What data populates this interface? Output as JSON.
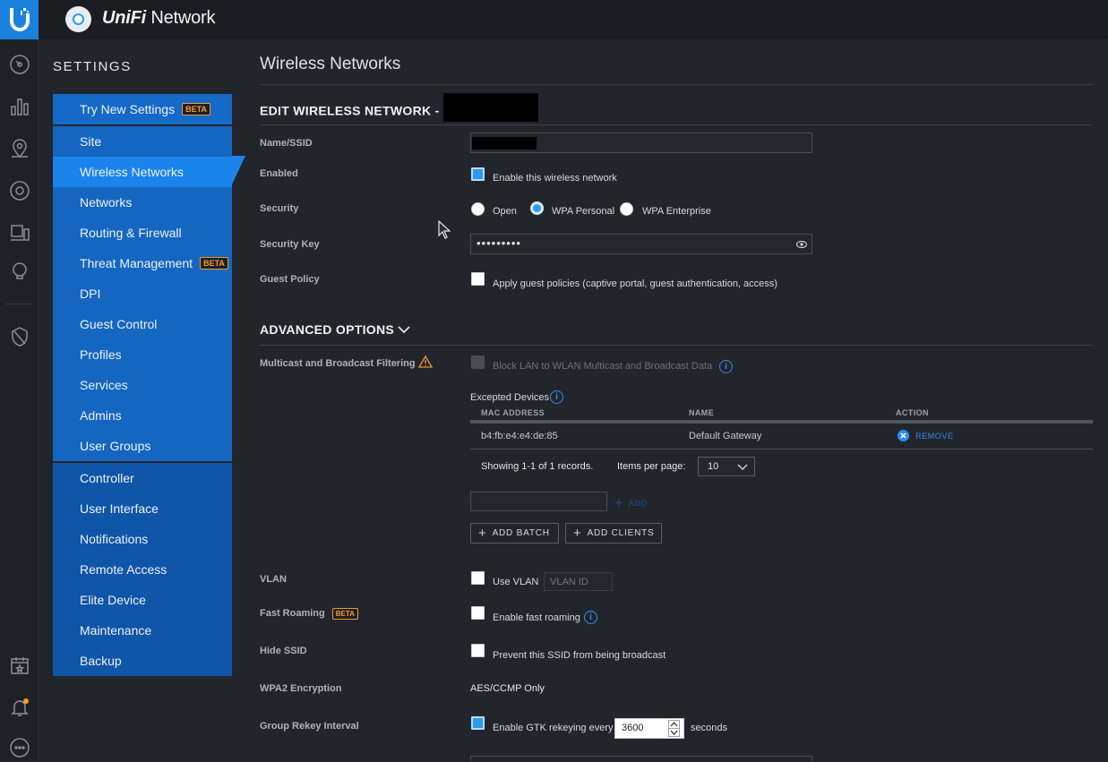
{
  "app": {
    "brand_prefix": "UniFi",
    "brand_suffix": " Network"
  },
  "sidebar": {
    "title": "SETTINGS",
    "group1": [
      {
        "label": "Try New Settings",
        "badge": "BETA"
      }
    ],
    "group2": [
      {
        "label": "Site"
      },
      {
        "label": "Wireless Networks",
        "active": true
      },
      {
        "label": "Networks"
      },
      {
        "label": "Routing & Firewall"
      },
      {
        "label": "Threat Management",
        "badge": "BETA"
      },
      {
        "label": "DPI"
      },
      {
        "label": "Guest Control"
      },
      {
        "label": "Profiles"
      },
      {
        "label": "Services"
      },
      {
        "label": "Admins"
      },
      {
        "label": "User Groups"
      }
    ],
    "group3": [
      {
        "label": "Controller"
      },
      {
        "label": "User Interface"
      },
      {
        "label": "Notifications"
      },
      {
        "label": "Remote Access"
      },
      {
        "label": "Elite Device"
      },
      {
        "label": "Maintenance"
      },
      {
        "label": "Backup"
      }
    ]
  },
  "main": {
    "page_title": "Wireless Networks",
    "edit_title": "EDIT WIRELESS NETWORK -",
    "labels": {
      "name_ssid": "Name/SSID",
      "enabled": "Enabled",
      "security": "Security",
      "security_key": "Security Key",
      "guest_policy": "Guest Policy",
      "multicast": "Multicast and Broadcast Filtering",
      "vlan": "VLAN",
      "fast_roaming": "Fast Roaming",
      "hide_ssid": "Hide SSID",
      "wpa2_encryption": "WPA2 Encryption",
      "group_rekey": "Group Rekey Interval"
    },
    "enabled_text": "Enable this wireless network",
    "security_options": [
      "Open",
      "WPA Personal",
      "WPA Enterprise"
    ],
    "security_selected": "WPA Personal",
    "security_key_value": "•••••••••",
    "guest_policy_text": "Apply guest policies (captive portal, guest authentication, access)",
    "advanced_title": "ADVANCED OPTIONS",
    "multicast_text": "Block LAN to WLAN Multicast and Broadcast Data",
    "excepted_title": "Excepted Devices",
    "table": {
      "headers": [
        "MAC ADDRESS",
        "NAME",
        "ACTION"
      ],
      "rows": [
        {
          "mac": "b4:fb:e4:e4:de:85",
          "name": "Default Gateway",
          "action": "REMOVE"
        }
      ]
    },
    "pagination_text": "Showing 1-1 of 1 records.",
    "items_per_page_label": "Items per page:",
    "items_per_page_value": "10",
    "add_label": "ADD",
    "add_batch": "ADD BATCH",
    "add_clients": "ADD CLIENTS",
    "vlan_text": "Use VLAN",
    "vlan_placeholder": "VLAN ID",
    "fast_roaming_badge": "BETA",
    "fast_roaming_text": "Enable fast roaming",
    "hide_ssid_text": "Prevent this SSID from being broadcast",
    "wpa2_value": "AES/CCMP Only",
    "rekey_text": "Enable GTK rekeying every",
    "rekey_value": "3600",
    "rekey_unit": "seconds"
  },
  "colors": {
    "accent": "#1a84ec",
    "beta": "#f29a2e",
    "info": "#2b8ff0"
  }
}
